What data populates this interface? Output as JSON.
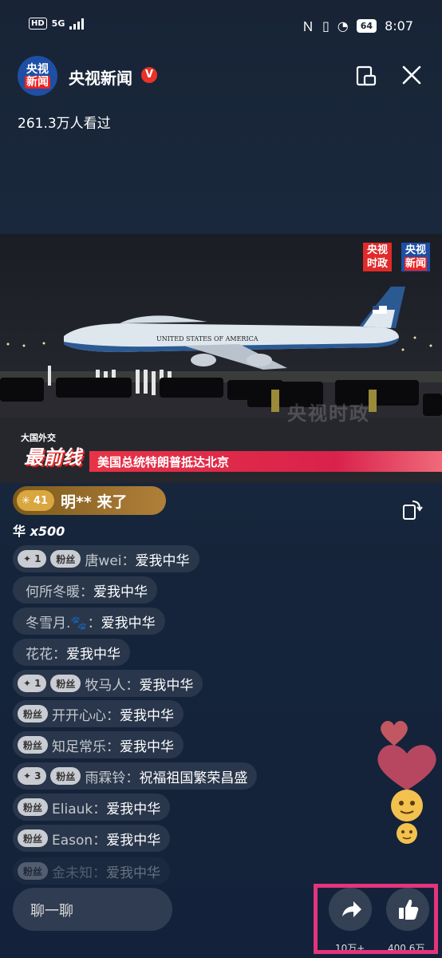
{
  "status_bar": {
    "hd": "HD",
    "network": "5G",
    "battery": "64",
    "time": "8:07"
  },
  "header": {
    "avatar_line1": "央视",
    "avatar_line2": "新闻",
    "channel_name": "央视新闻",
    "verified": "V",
    "viewers": "261.3万人看过"
  },
  "video": {
    "logo_politics": [
      "央视",
      "时政"
    ],
    "logo_news": [
      "央视",
      "新闻"
    ],
    "plane_text": "UNITED STATES OF AMERICA",
    "program_small": "大国外交",
    "program_big": "最前线",
    "ticker": "美国总统特朗普抵达北京",
    "watermark": "央视时政"
  },
  "join": {
    "level": "41",
    "text": "明** 来了"
  },
  "gift": {
    "name": "华",
    "qty": "x500"
  },
  "comments": [
    {
      "level": "1",
      "fan": "粉丝",
      "user": "唐wei：",
      "msg": "爱我中华"
    },
    {
      "level": "",
      "fan": "",
      "user": "何所冬暖：",
      "msg": "爱我中华"
    },
    {
      "level": "",
      "fan": "",
      "user": "冬雪月.🐾：",
      "msg": "爱我中华"
    },
    {
      "level": "",
      "fan": "",
      "user": "花花：",
      "msg": "爱我中华"
    },
    {
      "level": "1",
      "fan": "粉丝",
      "user": "牧马人：",
      "msg": "爱我中华"
    },
    {
      "level": "",
      "fan": "粉丝",
      "user": "开开心心：",
      "msg": "爱我中华"
    },
    {
      "level": "",
      "fan": "粉丝",
      "user": "知足常乐：",
      "msg": "爱我中华"
    },
    {
      "level": "3",
      "fan": "粉丝",
      "user": "雨霖铃：",
      "msg": "祝福祖国繁荣昌盛"
    },
    {
      "level": "",
      "fan": "粉丝",
      "user": "Eliauk：",
      "msg": "爱我中华"
    },
    {
      "level": "",
      "fan": "粉丝",
      "user": "Eason：",
      "msg": "爱我中华"
    },
    {
      "level": "",
      "fan": "粉丝",
      "user": "金未知：",
      "msg": "爱我中华"
    }
  ],
  "bottom": {
    "chat_placeholder": "聊一聊",
    "share_count": "10万+",
    "like_count": "400.6万"
  },
  "colors": {
    "background": "#182436",
    "ticker": "#e63346",
    "highlight": "#e3347c",
    "join_banner": "#b0803a"
  }
}
